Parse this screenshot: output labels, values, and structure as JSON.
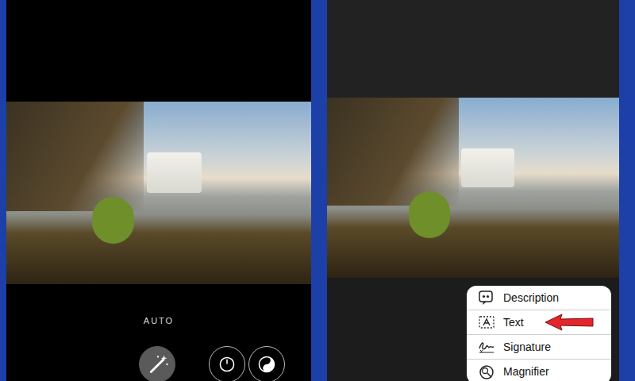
{
  "left_screen": {
    "mode_label": "AUTO",
    "tools": [
      {
        "kind": "wand",
        "selected": true
      },
      {
        "kind": "dial",
        "selected": false
      },
      {
        "kind": "contrast",
        "selected": false
      }
    ]
  },
  "markup_menu": {
    "items": [
      {
        "label": "Description",
        "kind": "quote",
        "annotated": false
      },
      {
        "label": "Text",
        "kind": "text",
        "annotated": true
      },
      {
        "label": "Signature",
        "kind": "signature",
        "annotated": false
      },
      {
        "label": "Magnifier",
        "kind": "magnifier",
        "annotated": false
      }
    ]
  }
}
